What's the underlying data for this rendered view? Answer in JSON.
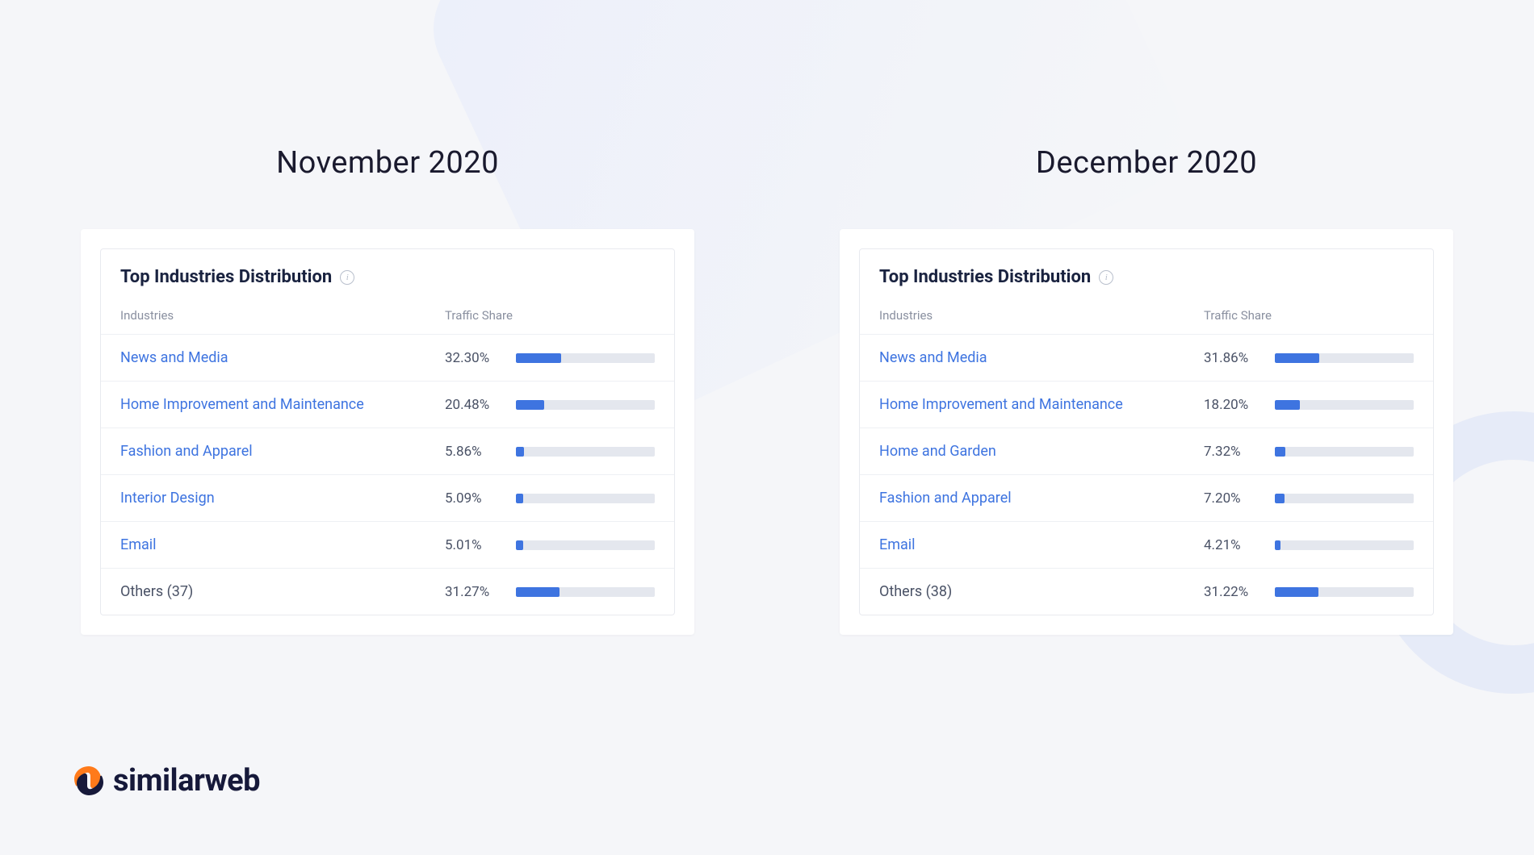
{
  "brand": "similarweb",
  "panels": [
    {
      "title": "November 2020",
      "card_title": "Top Industries Distribution",
      "col_industries": "Industries",
      "col_traffic": "Traffic Share",
      "rows": [
        {
          "name": "News and Media",
          "pct": "32.30%",
          "val": 32.3,
          "link": true
        },
        {
          "name": "Home Improvement and Maintenance",
          "pct": "20.48%",
          "val": 20.48,
          "link": true
        },
        {
          "name": "Fashion and Apparel",
          "pct": "5.86%",
          "val": 5.86,
          "link": true
        },
        {
          "name": "Interior Design",
          "pct": "5.09%",
          "val": 5.09,
          "link": true
        },
        {
          "name": "Email",
          "pct": "5.01%",
          "val": 5.01,
          "link": true
        },
        {
          "name": "Others (37)",
          "pct": "31.27%",
          "val": 31.27,
          "link": false
        }
      ]
    },
    {
      "title": "December 2020",
      "card_title": "Top Industries Distribution",
      "col_industries": "Industries",
      "col_traffic": "Traffic Share",
      "rows": [
        {
          "name": "News and Media",
          "pct": "31.86%",
          "val": 31.86,
          "link": true
        },
        {
          "name": "Home Improvement and Maintenance",
          "pct": "18.20%",
          "val": 18.2,
          "link": true
        },
        {
          "name": "Home and Garden",
          "pct": "7.32%",
          "val": 7.32,
          "link": true
        },
        {
          "name": "Fashion and Apparel",
          "pct": "7.20%",
          "val": 7.2,
          "link": true
        },
        {
          "name": "Email",
          "pct": "4.21%",
          "val": 4.21,
          "link": true
        },
        {
          "name": "Others (38)",
          "pct": "31.22%",
          "val": 31.22,
          "link": false
        }
      ]
    }
  ],
  "chart_data": [
    {
      "type": "bar",
      "title": "Top Industries Distribution — November 2020",
      "xlabel": "Industries",
      "ylabel": "Traffic Share (%)",
      "ylim": [
        0,
        100
      ],
      "categories": [
        "News and Media",
        "Home Improvement and Maintenance",
        "Fashion and Apparel",
        "Interior Design",
        "Email",
        "Others (37)"
      ],
      "values": [
        32.3,
        20.48,
        5.86,
        5.09,
        5.01,
        31.27
      ]
    },
    {
      "type": "bar",
      "title": "Top Industries Distribution — December 2020",
      "xlabel": "Industries",
      "ylabel": "Traffic Share (%)",
      "ylim": [
        0,
        100
      ],
      "categories": [
        "News and Media",
        "Home Improvement and Maintenance",
        "Home and Garden",
        "Fashion and Apparel",
        "Email",
        "Others (38)"
      ],
      "values": [
        31.86,
        18.2,
        7.32,
        7.2,
        4.21,
        31.22
      ]
    }
  ]
}
